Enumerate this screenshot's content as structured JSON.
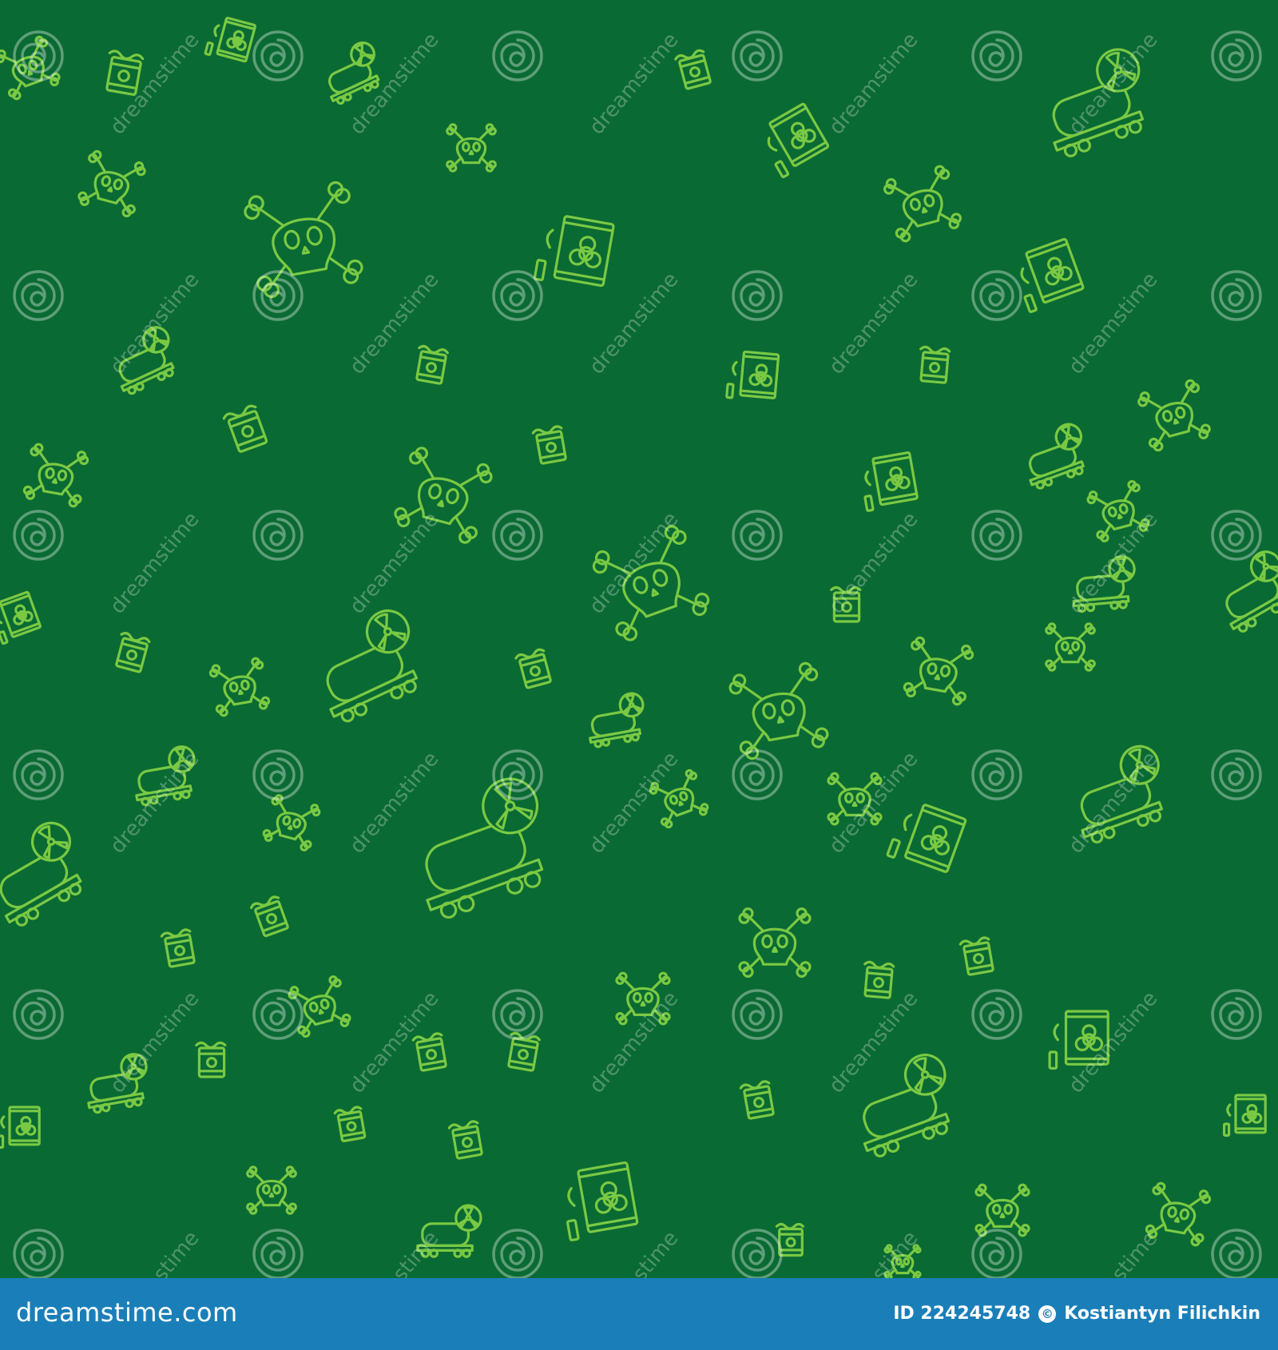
{
  "background_color": "#0a6a33",
  "icon_color": "#7ac943",
  "watermark_text": "dreamstime",
  "footer": {
    "color": "#1a7fb8",
    "logo_text": "dreamstime.com",
    "id_text": "ID 224245748",
    "author": "Kostiantyn Filichkin"
  }
}
